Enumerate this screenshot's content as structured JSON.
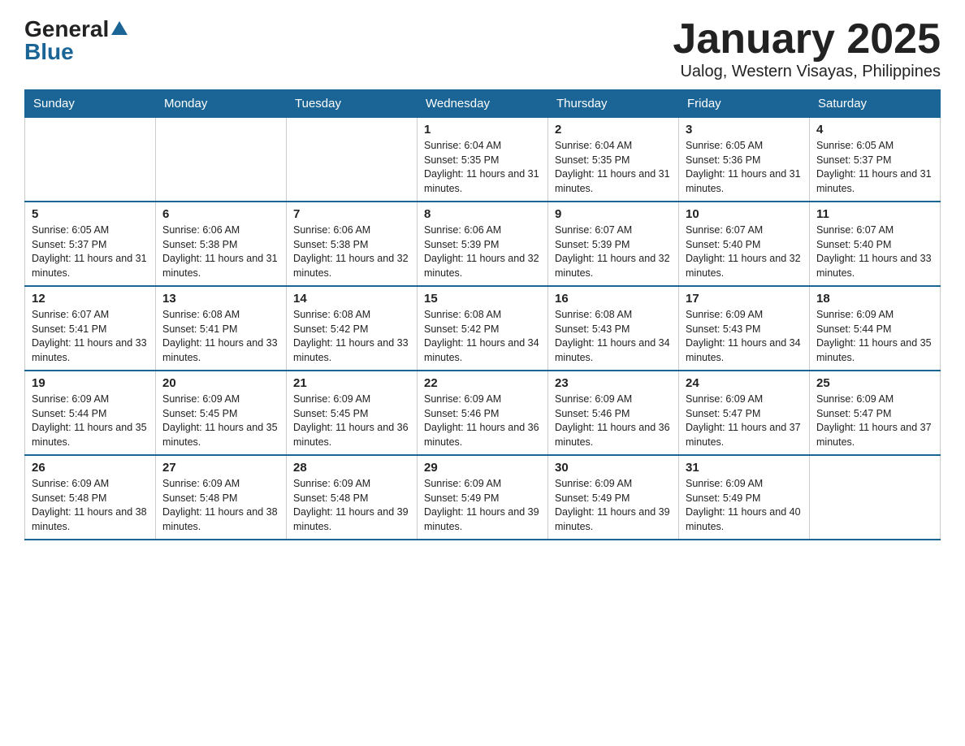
{
  "header": {
    "logo_general": "General",
    "logo_blue": "Blue",
    "title": "January 2025",
    "subtitle": "Ualog, Western Visayas, Philippines"
  },
  "calendar": {
    "days": [
      "Sunday",
      "Monday",
      "Tuesday",
      "Wednesday",
      "Thursday",
      "Friday",
      "Saturday"
    ],
    "weeks": [
      [
        {
          "day": "",
          "info": ""
        },
        {
          "day": "",
          "info": ""
        },
        {
          "day": "",
          "info": ""
        },
        {
          "day": "1",
          "info": "Sunrise: 6:04 AM\nSunset: 5:35 PM\nDaylight: 11 hours and 31 minutes."
        },
        {
          "day": "2",
          "info": "Sunrise: 6:04 AM\nSunset: 5:35 PM\nDaylight: 11 hours and 31 minutes."
        },
        {
          "day": "3",
          "info": "Sunrise: 6:05 AM\nSunset: 5:36 PM\nDaylight: 11 hours and 31 minutes."
        },
        {
          "day": "4",
          "info": "Sunrise: 6:05 AM\nSunset: 5:37 PM\nDaylight: 11 hours and 31 minutes."
        }
      ],
      [
        {
          "day": "5",
          "info": "Sunrise: 6:05 AM\nSunset: 5:37 PM\nDaylight: 11 hours and 31 minutes."
        },
        {
          "day": "6",
          "info": "Sunrise: 6:06 AM\nSunset: 5:38 PM\nDaylight: 11 hours and 31 minutes."
        },
        {
          "day": "7",
          "info": "Sunrise: 6:06 AM\nSunset: 5:38 PM\nDaylight: 11 hours and 32 minutes."
        },
        {
          "day": "8",
          "info": "Sunrise: 6:06 AM\nSunset: 5:39 PM\nDaylight: 11 hours and 32 minutes."
        },
        {
          "day": "9",
          "info": "Sunrise: 6:07 AM\nSunset: 5:39 PM\nDaylight: 11 hours and 32 minutes."
        },
        {
          "day": "10",
          "info": "Sunrise: 6:07 AM\nSunset: 5:40 PM\nDaylight: 11 hours and 32 minutes."
        },
        {
          "day": "11",
          "info": "Sunrise: 6:07 AM\nSunset: 5:40 PM\nDaylight: 11 hours and 33 minutes."
        }
      ],
      [
        {
          "day": "12",
          "info": "Sunrise: 6:07 AM\nSunset: 5:41 PM\nDaylight: 11 hours and 33 minutes."
        },
        {
          "day": "13",
          "info": "Sunrise: 6:08 AM\nSunset: 5:41 PM\nDaylight: 11 hours and 33 minutes."
        },
        {
          "day": "14",
          "info": "Sunrise: 6:08 AM\nSunset: 5:42 PM\nDaylight: 11 hours and 33 minutes."
        },
        {
          "day": "15",
          "info": "Sunrise: 6:08 AM\nSunset: 5:42 PM\nDaylight: 11 hours and 34 minutes."
        },
        {
          "day": "16",
          "info": "Sunrise: 6:08 AM\nSunset: 5:43 PM\nDaylight: 11 hours and 34 minutes."
        },
        {
          "day": "17",
          "info": "Sunrise: 6:09 AM\nSunset: 5:43 PM\nDaylight: 11 hours and 34 minutes."
        },
        {
          "day": "18",
          "info": "Sunrise: 6:09 AM\nSunset: 5:44 PM\nDaylight: 11 hours and 35 minutes."
        }
      ],
      [
        {
          "day": "19",
          "info": "Sunrise: 6:09 AM\nSunset: 5:44 PM\nDaylight: 11 hours and 35 minutes."
        },
        {
          "day": "20",
          "info": "Sunrise: 6:09 AM\nSunset: 5:45 PM\nDaylight: 11 hours and 35 minutes."
        },
        {
          "day": "21",
          "info": "Sunrise: 6:09 AM\nSunset: 5:45 PM\nDaylight: 11 hours and 36 minutes."
        },
        {
          "day": "22",
          "info": "Sunrise: 6:09 AM\nSunset: 5:46 PM\nDaylight: 11 hours and 36 minutes."
        },
        {
          "day": "23",
          "info": "Sunrise: 6:09 AM\nSunset: 5:46 PM\nDaylight: 11 hours and 36 minutes."
        },
        {
          "day": "24",
          "info": "Sunrise: 6:09 AM\nSunset: 5:47 PM\nDaylight: 11 hours and 37 minutes."
        },
        {
          "day": "25",
          "info": "Sunrise: 6:09 AM\nSunset: 5:47 PM\nDaylight: 11 hours and 37 minutes."
        }
      ],
      [
        {
          "day": "26",
          "info": "Sunrise: 6:09 AM\nSunset: 5:48 PM\nDaylight: 11 hours and 38 minutes."
        },
        {
          "day": "27",
          "info": "Sunrise: 6:09 AM\nSunset: 5:48 PM\nDaylight: 11 hours and 38 minutes."
        },
        {
          "day": "28",
          "info": "Sunrise: 6:09 AM\nSunset: 5:48 PM\nDaylight: 11 hours and 39 minutes."
        },
        {
          "day": "29",
          "info": "Sunrise: 6:09 AM\nSunset: 5:49 PM\nDaylight: 11 hours and 39 minutes."
        },
        {
          "day": "30",
          "info": "Sunrise: 6:09 AM\nSunset: 5:49 PM\nDaylight: 11 hours and 39 minutes."
        },
        {
          "day": "31",
          "info": "Sunrise: 6:09 AM\nSunset: 5:49 PM\nDaylight: 11 hours and 40 minutes."
        },
        {
          "day": "",
          "info": ""
        }
      ]
    ]
  }
}
